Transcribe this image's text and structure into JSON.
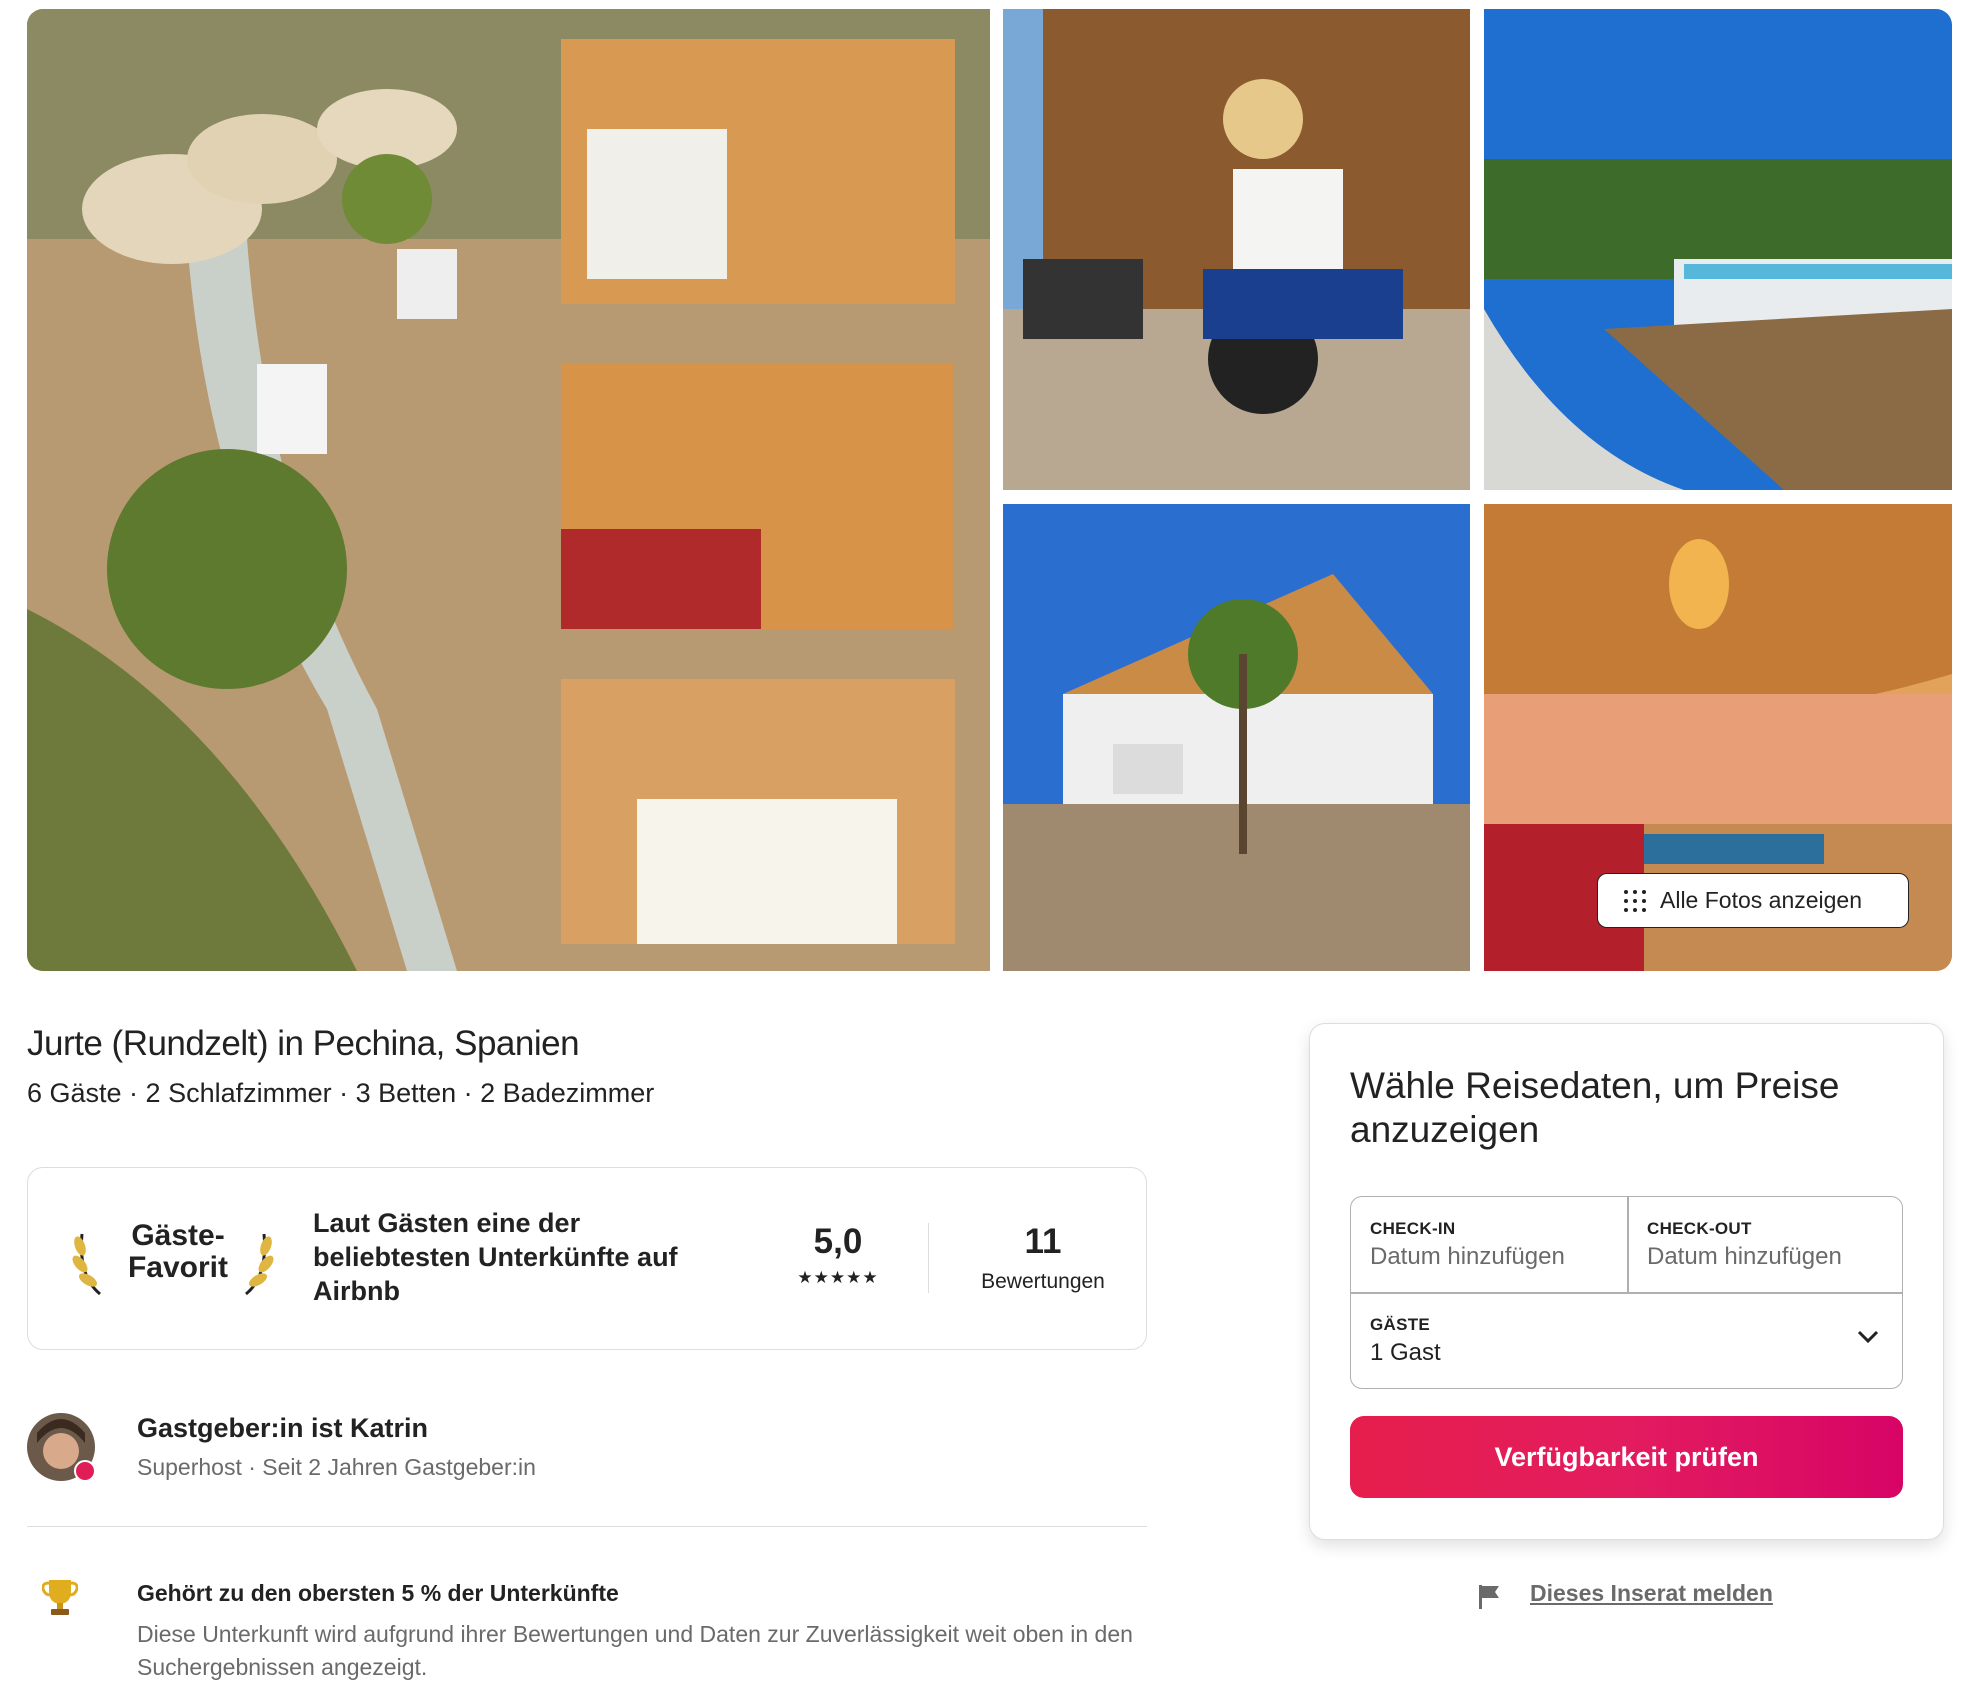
{
  "gallery": {
    "photos": [
      {
        "name": "Luftaufnahme des Jurtencamps"
      },
      {
        "name": "Kinder auf Tretauto"
      },
      {
        "name": "Pool"
      },
      {
        "name": "Sanitärgebäude"
      },
      {
        "name": "Jurte innen"
      }
    ],
    "show_all_label": "Alle Fotos anzeigen"
  },
  "listing": {
    "title": "Jurte (Rundzelt) in Pechina, Spanien",
    "subtitle": "6 Gäste · 2 Schlafzimmer · 3 Betten · 2 Badezimmer"
  },
  "guest_favorite": {
    "badge_line1": "Gäste-",
    "badge_line2": "Favorit",
    "description": "Laut Gästen eine der beliebtesten Unterkünfte auf Airbnb",
    "rating": "5,0",
    "stars": "★★★★★",
    "reviews_count": "11",
    "reviews_label": "Bewertungen"
  },
  "host": {
    "name_line": "Gastgeber:in ist Katrin",
    "sub_line": "Superhost · Seit 2 Jahren Gastgeber:in"
  },
  "highlight": {
    "title": "Gehört zu den obersten 5 % der Unterkünfte",
    "description": "Diese Unterkunft wird aufgrund ihrer Bewertungen und Daten zur Zuverlässigkeit weit oben in den Suchergebnissen angezeigt."
  },
  "booking": {
    "title": "Wähle Reisedaten, um Preise anzuzeigen",
    "checkin_label": "CHECK-IN",
    "checkin_value": "Datum hinzufügen",
    "checkout_label": "CHECK-OUT",
    "checkout_value": "Datum hinzufügen",
    "guests_label": "GÄSTE",
    "guests_value": "1 Gast",
    "button_label": "Verfügbarkeit prüfen",
    "accent_color": "#e31c5f"
  },
  "report": {
    "label": "Dieses Inserat melden"
  }
}
